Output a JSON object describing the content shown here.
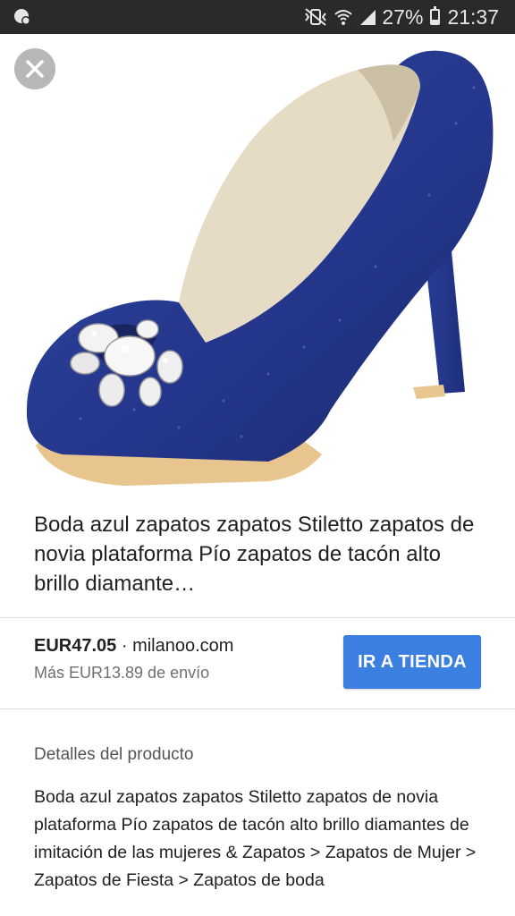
{
  "status_bar": {
    "battery": "27%",
    "battery_level": 0.27,
    "time": "21:37",
    "icons": [
      "android-debug-icon",
      "mute-vibrate-icon",
      "wifi-icon",
      "signal-icon",
      "battery-icon"
    ]
  },
  "product": {
    "image_description_icon": "shoe-image",
    "title": "Boda azul zapatos zapatos Stiletto zapatos de novia plataforma Pío zapatos de tacón alto brillo diamante…",
    "price": "EUR47.05",
    "separator": "·",
    "store": "milanoo.com",
    "shipping": "Más EUR13.89 de envío",
    "cta_label": "IR A TIENDA",
    "details_heading": "Detalles del producto",
    "details_text": "Boda azul zapatos zapatos Stiletto zapatos de novia plataforma Pío zapatos de tacón alto brillo diamantes de imitación de las mujeres & Zapatos > Zapatos de Mujer > Zapatos de Fiesta > Zapatos de boda"
  },
  "colors": {
    "status_bar": "#2a2a2a",
    "cta": "#3b7fe0",
    "shoe_blue": "#2c3f95"
  }
}
